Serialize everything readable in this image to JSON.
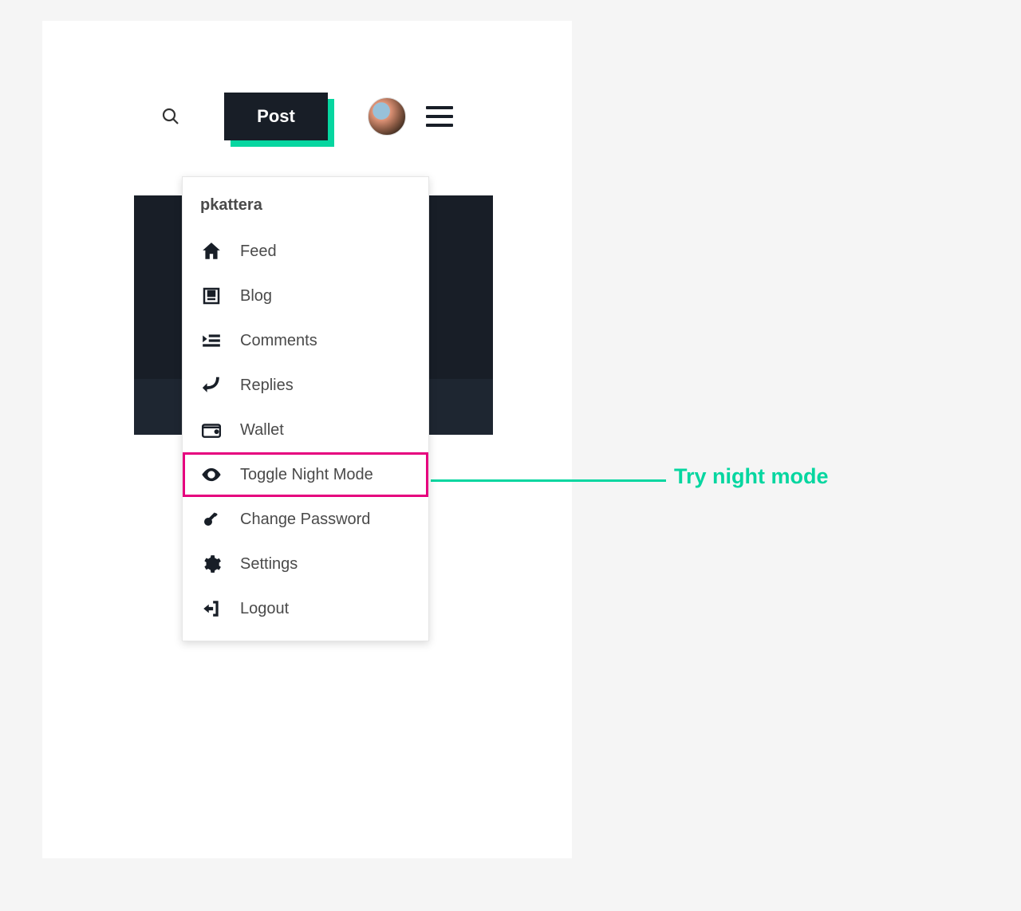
{
  "topbar": {
    "post_label": "Post"
  },
  "dropdown": {
    "username": "pkattera",
    "items": [
      {
        "label": "Feed",
        "icon": "home-icon",
        "highlighted": false
      },
      {
        "label": "Blog",
        "icon": "blog-icon",
        "highlighted": false
      },
      {
        "label": "Comments",
        "icon": "comments-icon",
        "highlighted": false
      },
      {
        "label": "Replies",
        "icon": "replies-icon",
        "highlighted": false
      },
      {
        "label": "Wallet",
        "icon": "wallet-icon",
        "highlighted": false
      },
      {
        "label": "Toggle Night Mode",
        "icon": "eye-icon",
        "highlighted": true
      },
      {
        "label": "Change Password",
        "icon": "key-icon",
        "highlighted": false
      },
      {
        "label": "Settings",
        "icon": "gear-icon",
        "highlighted": false
      },
      {
        "label": "Logout",
        "icon": "logout-icon",
        "highlighted": false
      }
    ]
  },
  "callout": {
    "text": "Try night mode",
    "color": "#06d6a0"
  },
  "colors": {
    "accent": "#06d6a0",
    "dark": "#181e27",
    "highlight": "#e6007e"
  }
}
